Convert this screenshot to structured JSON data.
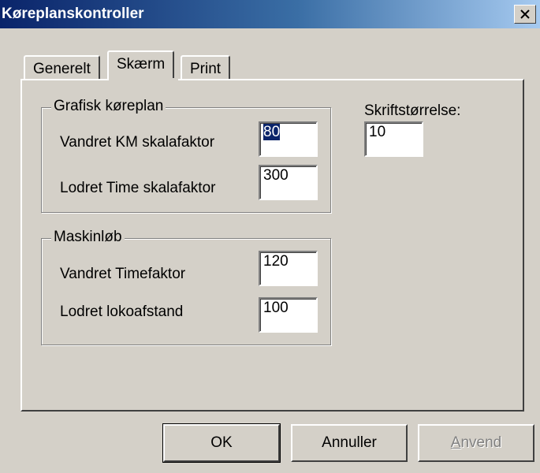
{
  "window": {
    "title": "Køreplanskontroller"
  },
  "tabs": [
    {
      "label": "Generelt",
      "active": false
    },
    {
      "label": "Skærm",
      "active": true
    },
    {
      "label": "Print",
      "active": false
    }
  ],
  "grafisk": {
    "legend": "Grafisk køreplan",
    "vandret_label": "Vandret KM skalafaktor",
    "vandret_value": "80",
    "lodret_label": "Lodret Time skalafaktor",
    "lodret_value": "300"
  },
  "maskin": {
    "legend": "Maskinløb",
    "vandret_label": "Vandret Timefaktor",
    "vandret_value": "120",
    "lodret_label": "Lodret lokoafstand",
    "lodret_value": "100"
  },
  "font": {
    "label": "Skriftstørrelse:",
    "value": "10"
  },
  "buttons": {
    "ok": "OK",
    "cancel": "Annuller",
    "apply_first": "A",
    "apply_rest": "nvend"
  },
  "colors": {
    "titlebar": "#0a246a",
    "face": "#d4d0c8",
    "selection": "#0a246a"
  },
  "icons": [
    "close-icon"
  ]
}
